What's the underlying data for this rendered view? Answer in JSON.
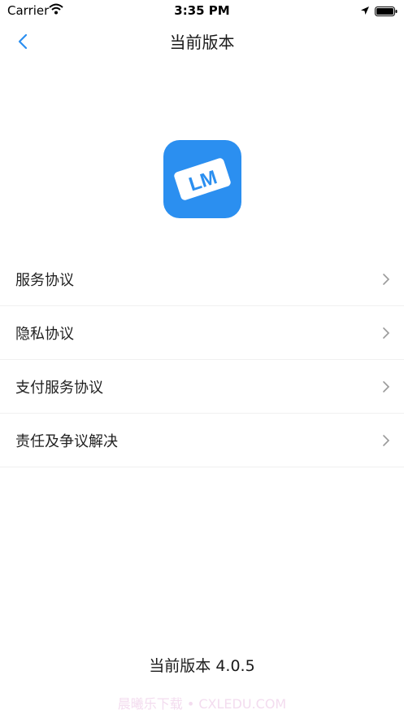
{
  "status_bar": {
    "carrier": "Carrier",
    "time": "3:35 PM",
    "icons": [
      "wifi-icon",
      "location-arrow-icon",
      "battery-icon"
    ]
  },
  "nav": {
    "title": "当前版本",
    "back_icon": "chevron-left-icon",
    "accent_color": "#2b8ff0"
  },
  "logo": {
    "text": "LM",
    "background_color": "#2b8ff0"
  },
  "menu": {
    "items": [
      {
        "label": "服务协议"
      },
      {
        "label": "隐私协议"
      },
      {
        "label": "支付服务协议"
      },
      {
        "label": "责任及争议解决"
      }
    ],
    "chevron_icon": "chevron-right-icon"
  },
  "footer": {
    "version_text": "当前版本 4.0.5",
    "watermark": "晨曦乐下载 • CXLEDU.COM"
  }
}
